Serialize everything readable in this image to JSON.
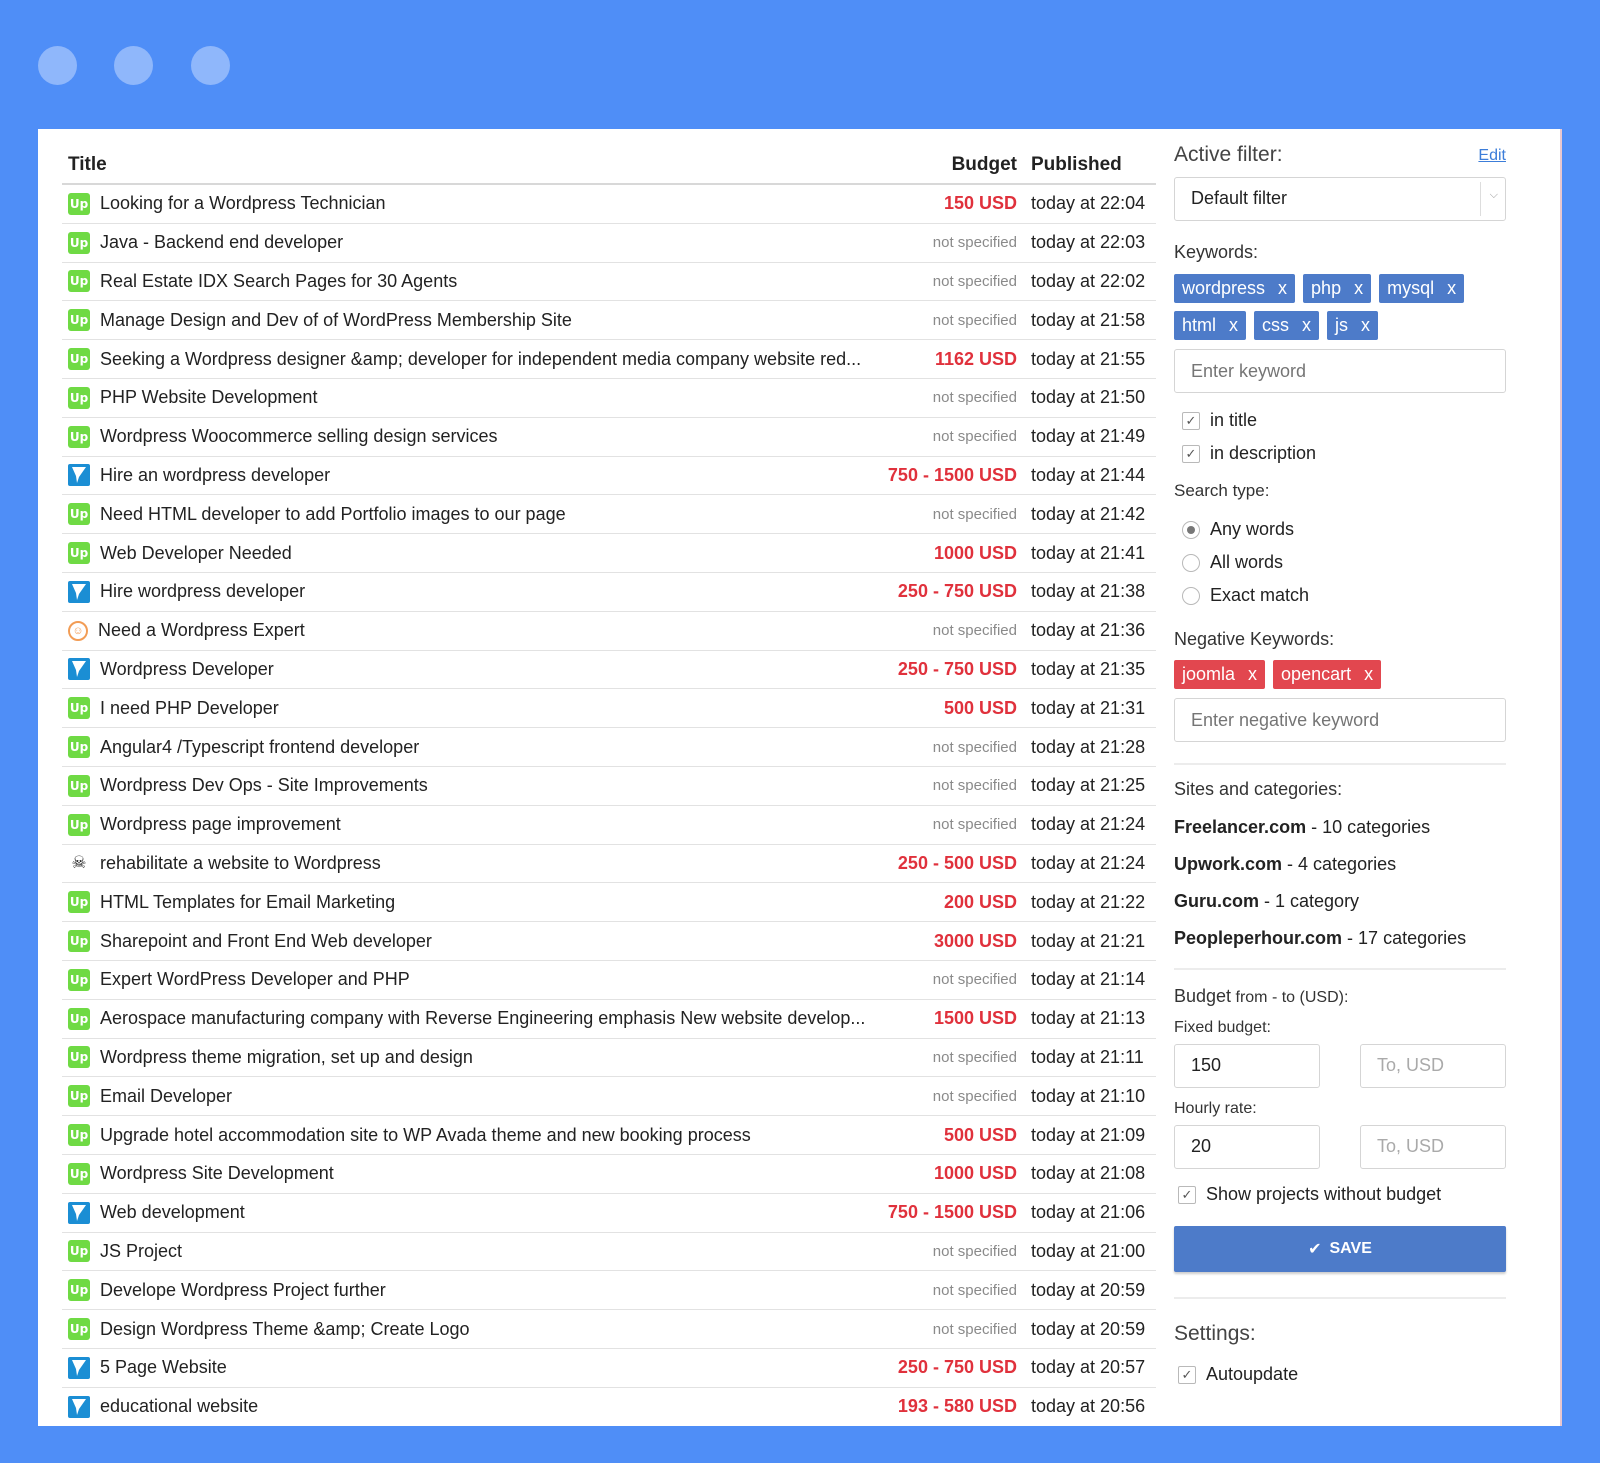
{
  "table": {
    "headers": {
      "title": "Title",
      "budget": "Budget",
      "published": "Published"
    },
    "rows": [
      {
        "site": "upwork",
        "title": "Looking for a Wordpress Technician",
        "budget": "150 USD",
        "specified": true,
        "published": "today at 22:04"
      },
      {
        "site": "upwork",
        "title": "Java - Backend end developer",
        "budget": "not specified",
        "specified": false,
        "published": "today at 22:03"
      },
      {
        "site": "upwork",
        "title": "Real Estate IDX Search Pages for 30 Agents",
        "budget": "not specified",
        "specified": false,
        "published": "today at 22:02"
      },
      {
        "site": "upwork",
        "title": "Manage Design and Dev of of WordPress Membership Site",
        "budget": "not specified",
        "specified": false,
        "published": "today at 21:58"
      },
      {
        "site": "upwork",
        "title": "Seeking a Wordpress designer &amp; developer for independent media company website red...",
        "budget": "1162 USD",
        "specified": true,
        "published": "today at 21:55"
      },
      {
        "site": "upwork",
        "title": "PHP Website Development",
        "budget": "not specified",
        "specified": false,
        "published": "today at 21:50"
      },
      {
        "site": "upwork",
        "title": "Wordpress Woocommerce selling design services",
        "budget": "not specified",
        "specified": false,
        "published": "today at 21:49"
      },
      {
        "site": "freelancer",
        "title": "Hire an wordpress developer",
        "budget": "750 - 1500 USD",
        "specified": true,
        "published": "today at 21:44"
      },
      {
        "site": "upwork",
        "title": "Need HTML developer to add Portfolio images to our page",
        "budget": "not specified",
        "specified": false,
        "published": "today at 21:42"
      },
      {
        "site": "upwork",
        "title": "Web Developer Needed",
        "budget": "1000 USD",
        "specified": true,
        "published": "today at 21:41"
      },
      {
        "site": "freelancer",
        "title": "Hire wordpress developer",
        "budget": "250 - 750 USD",
        "specified": true,
        "published": "today at 21:38"
      },
      {
        "site": "peopleperhour",
        "title": "Need a Wordpress Expert",
        "budget": "not specified",
        "specified": false,
        "published": "today at 21:36"
      },
      {
        "site": "freelancer",
        "title": "Wordpress Developer",
        "budget": "250 - 750 USD",
        "specified": true,
        "published": "today at 21:35"
      },
      {
        "site": "upwork",
        "title": "I need PHP Developer",
        "budget": "500 USD",
        "specified": true,
        "published": "today at 21:31"
      },
      {
        "site": "upwork",
        "title": "Angular4 /Typescript frontend developer",
        "budget": "not specified",
        "specified": false,
        "published": "today at 21:28"
      },
      {
        "site": "upwork",
        "title": "Wordpress Dev Ops - Site Improvements",
        "budget": "not specified",
        "specified": false,
        "published": "today at 21:25"
      },
      {
        "site": "upwork",
        "title": "Wordpress page improvement",
        "budget": "not specified",
        "specified": false,
        "published": "today at 21:24"
      },
      {
        "site": "guru",
        "title": "rehabilitate a website to Wordpress",
        "budget": "250 - 500 USD",
        "specified": true,
        "published": "today at 21:24"
      },
      {
        "site": "upwork",
        "title": "HTML Templates for Email Marketing",
        "budget": "200 USD",
        "specified": true,
        "published": "today at 21:22"
      },
      {
        "site": "upwork",
        "title": "Sharepoint and Front End Web developer",
        "budget": "3000 USD",
        "specified": true,
        "published": "today at 21:21"
      },
      {
        "site": "upwork",
        "title": "Expert WordPress Developer and PHP",
        "budget": "not specified",
        "specified": false,
        "published": "today at 21:14"
      },
      {
        "site": "upwork",
        "title": "Aerospace manufacturing company with Reverse Engineering emphasis New website develop...",
        "budget": "1500 USD",
        "specified": true,
        "published": "today at 21:13"
      },
      {
        "site": "upwork",
        "title": "Wordpress theme migration, set up and design",
        "budget": "not specified",
        "specified": false,
        "published": "today at 21:11"
      },
      {
        "site": "upwork",
        "title": "Email Developer",
        "budget": "not specified",
        "specified": false,
        "published": "today at 21:10"
      },
      {
        "site": "upwork",
        "title": "Upgrade hotel accommodation site to WP Avada theme and new booking process",
        "budget": "500 USD",
        "specified": true,
        "published": "today at 21:09"
      },
      {
        "site": "upwork",
        "title": "Wordpress Site Development",
        "budget": "1000 USD",
        "specified": true,
        "published": "today at 21:08"
      },
      {
        "site": "freelancer",
        "title": "Web development",
        "budget": "750 - 1500 USD",
        "specified": true,
        "published": "today at 21:06"
      },
      {
        "site": "upwork",
        "title": "JS Project",
        "budget": "not specified",
        "specified": false,
        "published": "today at 21:00"
      },
      {
        "site": "upwork",
        "title": "Develope Wordpress Project further",
        "budget": "not specified",
        "specified": false,
        "published": "today at 20:59"
      },
      {
        "site": "upwork",
        "title": "Design Wordpress Theme &amp; Create Logo",
        "budget": "not specified",
        "specified": false,
        "published": "today at 20:59"
      },
      {
        "site": "freelancer",
        "title": "5 Page Website",
        "budget": "250 - 750 USD",
        "specified": true,
        "published": "today at 20:57"
      },
      {
        "site": "freelancer",
        "title": "educational website",
        "budget": "193 - 580 USD",
        "specified": true,
        "published": "today at 20:56"
      }
    ]
  },
  "sidebar": {
    "active_filter_label": "Active filter:",
    "edit_label": "Edit",
    "filter_value": "Default filter",
    "keywords_label": "Keywords:",
    "keywords": [
      "wordpress",
      "php",
      "mysql",
      "html",
      "css",
      "js"
    ],
    "keyword_placeholder": "Enter keyword",
    "in_title": "in title",
    "in_description": "in description",
    "search_type_label": "Search type:",
    "search_types": [
      "Any words",
      "All words",
      "Exact match"
    ],
    "negative_label": "Negative Keywords:",
    "negative_keywords": [
      "joomla",
      "opencart"
    ],
    "negative_placeholder": "Enter negative keyword",
    "sites_label": "Sites and categories:",
    "sites": [
      {
        "name": "Freelancer.com",
        "detail": " - 10 categories"
      },
      {
        "name": "Upwork.com",
        "detail": " - 4 categories"
      },
      {
        "name": "Guru.com",
        "detail": " - 1 category"
      },
      {
        "name": "Peopleperhour.com",
        "detail": " - 17 categories"
      }
    ],
    "budget_label": "Budget",
    "budget_sub": " from - to (USD):",
    "fixed_label": "Fixed budget:",
    "fixed_from": "150",
    "fixed_to_placeholder": "To, USD",
    "hourly_label": "Hourly rate:",
    "hourly_from": "20",
    "hourly_to_placeholder": "To, USD",
    "show_without_budget": "Show projects without budget",
    "save_label": "SAVE",
    "settings_label": "Settings:",
    "autoupdate_label": "Autoupdate"
  }
}
